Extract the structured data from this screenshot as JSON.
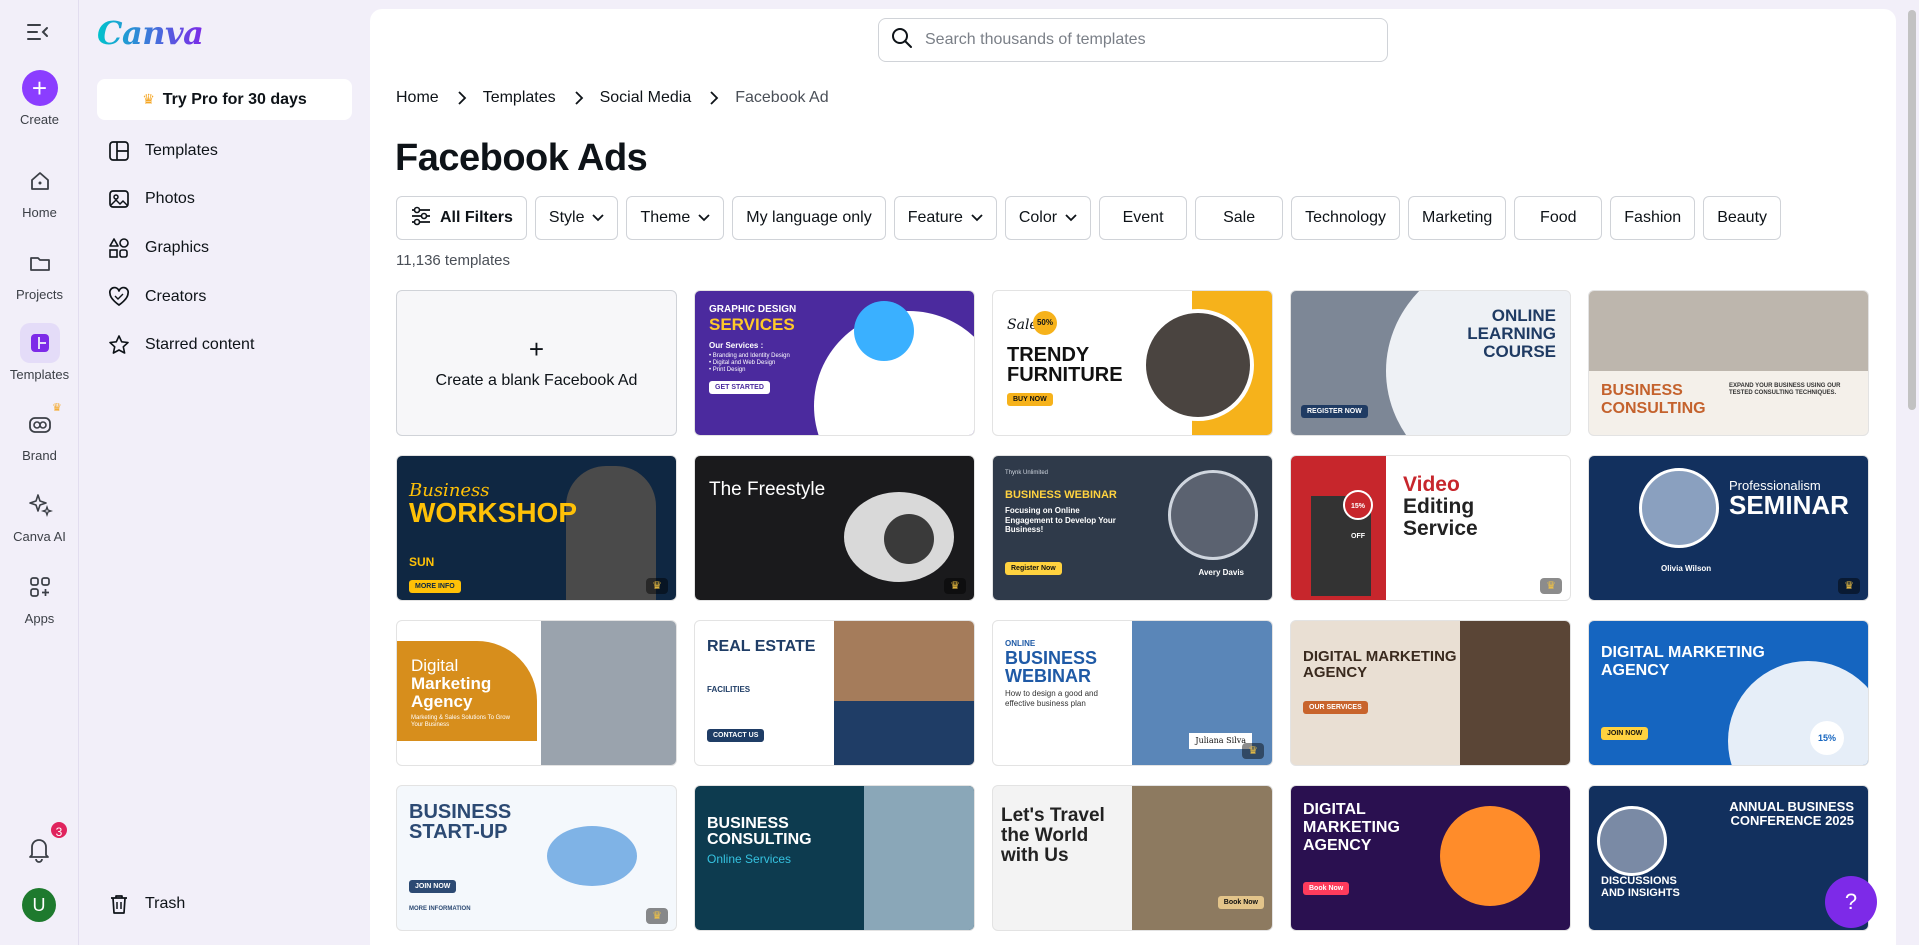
{
  "rail": {
    "create": "Create",
    "home": "Home",
    "projects": "Projects",
    "templates": "Templates",
    "brand": "Brand",
    "canva_ai": "Canva AI",
    "apps": "Apps",
    "notification_count": "3",
    "avatar_initial": "U"
  },
  "sidebar": {
    "logo": "Canva",
    "pro_button": "Try Pro for 30 days",
    "items": [
      {
        "label": "Templates",
        "icon": "templates-icon"
      },
      {
        "label": "Photos",
        "icon": "photo-icon"
      },
      {
        "label": "Graphics",
        "icon": "shapes-icon"
      },
      {
        "label": "Creators",
        "icon": "heart-icon"
      },
      {
        "label": "Starred content",
        "icon": "star-icon"
      }
    ],
    "trash": "Trash"
  },
  "search": {
    "placeholder": "Search thousands of templates"
  },
  "breadcrumb": [
    "Home",
    "Templates",
    "Social Media",
    "Facebook Ad"
  ],
  "page_title": "Facebook Ads",
  "filters": [
    {
      "label": "All Filters"
    },
    {
      "label": "Style"
    },
    {
      "label": "Theme"
    },
    {
      "label": "My language only"
    },
    {
      "label": "Feature"
    },
    {
      "label": "Color"
    },
    {
      "label": "Event"
    },
    {
      "label": "Sale"
    },
    {
      "label": "Technology"
    },
    {
      "label": "Marketing"
    },
    {
      "label": "Food"
    },
    {
      "label": "Fashion"
    },
    {
      "label": "Beauty"
    }
  ],
  "template_count": "11,136 templates",
  "blank_card": {
    "plus": "+",
    "label": "Create a blank Facebook Ad"
  },
  "templates": {
    "t1": {
      "title": "GRAPHIC DESIGN",
      "title2": "SERVICES",
      "sub": "Our Services :",
      "items": "• Branding and Identity Design\n• Digital and Web Design\n• Print Design",
      "cta": "GET STARTED"
    },
    "t2": {
      "script": "Sale",
      "badge": "50%",
      "title": "TRENDY",
      "title2": "FURNITURE",
      "cta": "BUY NOW"
    },
    "t3": {
      "title": "ONLINE",
      "title2": "LEARNING",
      "title3": "COURSE",
      "cta": "REGISTER NOW"
    },
    "t4": {
      "title": "BUSINESS",
      "title2": "CONSULTING",
      "sub": "EXPAND YOUR BUSINESS USING OUR TESTED CONSULTING TECHNIQUES."
    },
    "t5": {
      "script": "Business",
      "title": "WORKSHOP",
      "date": "SUN",
      "cta": "MORE INFO"
    },
    "t6": {
      "title": "The Freestyle"
    },
    "t7": {
      "brand": "Thynk Unlimited",
      "title": "BUSINESS WEBINAR",
      "sub": "Focusing on Online Engagement to Develop Your Business!",
      "cta": "Register Now",
      "name": "Avery Davis"
    },
    "t8": {
      "title": "Video",
      "title2": "Editing",
      "title3": "Service",
      "badge": "15% OFF"
    },
    "t9": {
      "sub": "Professionalism",
      "title": "SEMINAR",
      "name": "Olivia Wilson"
    },
    "t10": {
      "title": "Digital",
      "title2": "Marketing",
      "title3": "Agency",
      "sub": "Marketing & Sales Solutions To Grow Your Business"
    },
    "t11": {
      "title": "REAL ESTATE",
      "sub": "FACILITIES",
      "cta": "CONTACT US"
    },
    "t12": {
      "small": "ONLINE",
      "title": "BUSINESS",
      "title2": "WEBINAR",
      "sub": "How to design a good and effective business plan",
      "name": "Juliana Silva"
    },
    "t13": {
      "title": "DIGITAL MARKETING",
      "title2": "AGENCY",
      "cta": "OUR SERVICES"
    },
    "t14": {
      "title": "DIGITAL MARKETING",
      "title2": "AGENCY",
      "badge": "15%",
      "cta": "JOIN NOW"
    },
    "t15": {
      "title": "BUSINESS",
      "title2": "START-UP",
      "cta": "JOIN NOW",
      "sub": "MORE INFORMATION"
    },
    "t16": {
      "title": "BUSINESS",
      "title2": "CONSULTING",
      "sub": "Online Services"
    },
    "t17": {
      "title": "Let's Travel",
      "title2": "the World",
      "title3": "with Us",
      "cta": "Book Now"
    },
    "t18": {
      "title": "DIGITAL",
      "title2": "MARKETING",
      "title3": "AGENCY",
      "cta": "Book Now"
    },
    "t19": {
      "title": "ANNUAL BUSINESS",
      "title2": "CONFERENCE 2025",
      "sub": "DISCUSSIONS",
      "sub2": "AND INSIGHTS"
    }
  },
  "help": "?",
  "colors": {
    "brand": "#7d2ae8",
    "create": "#8b3dff",
    "badge": "#e0245e"
  }
}
